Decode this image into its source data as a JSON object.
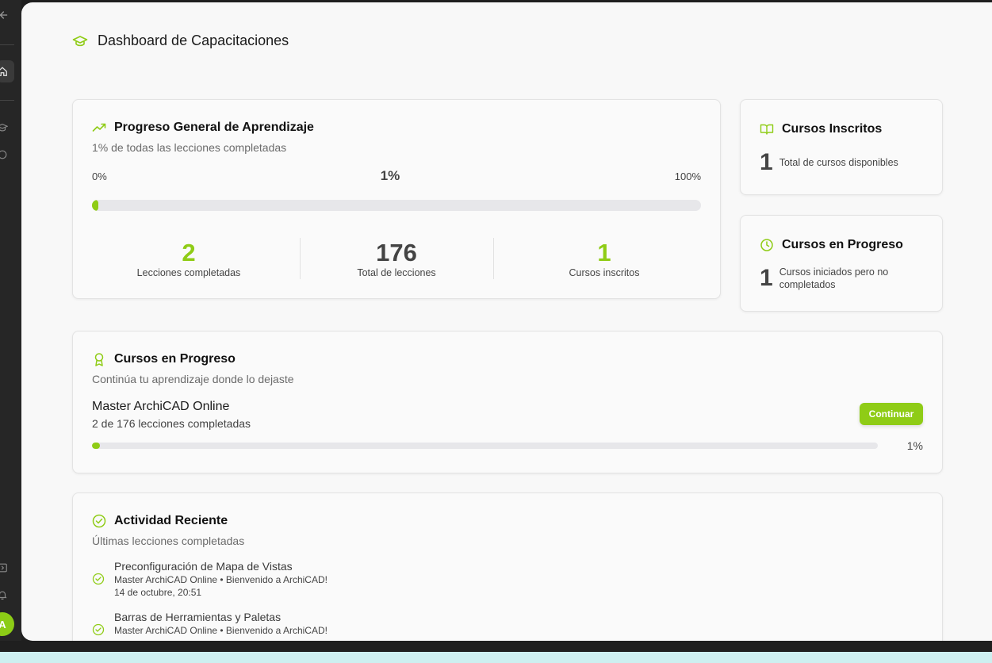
{
  "colors": {
    "accent": "#8fcc16",
    "sidebar": "#262626",
    "surface": "#f8f8f8"
  },
  "sidebar": {
    "icons": [
      "arrow-left-icon",
      "home-icon",
      "graduation-cap-icon",
      "circle-icon",
      "panel-icon",
      "bell-icon"
    ],
    "avatar_initial": "A"
  },
  "header": {
    "title": "Dashboard de Capacitaciones",
    "icon": "graduation-cap-icon"
  },
  "progress_card": {
    "title": "Progreso General de Aprendizaje",
    "subtitle": "1% de todas las lecciones completadas",
    "min_label": "0%",
    "current_label": "1%",
    "max_label": "100%",
    "progress_fraction": 0.01,
    "stats": [
      {
        "value": "2",
        "label": "Lecciones completadas",
        "color": "#8fcc16"
      },
      {
        "value": "176",
        "label": "Total de lecciones",
        "color": "#444444"
      },
      {
        "value": "1",
        "label": "Cursos inscritos",
        "color": "#8fcc16"
      }
    ]
  },
  "enrolled_card": {
    "title": "Cursos Inscritos",
    "value": "1",
    "description": "Total de cursos disponibles"
  },
  "in_progress_card": {
    "title": "Cursos en Progreso",
    "value": "1",
    "description": "Cursos iniciados pero no completados"
  },
  "courses_section": {
    "title": "Cursos en Progreso",
    "subtitle": "Continúa tu aprendizaje donde lo dejaste",
    "course": {
      "name": "Master ArchiCAD Online",
      "lessons_text": "2 de 176 lecciones completadas",
      "button_label": "Continuar",
      "progress_label": "1%",
      "progress_fraction": 0.01
    }
  },
  "activity_section": {
    "title": "Actividad Reciente",
    "subtitle": "Últimas lecciones completadas",
    "items": [
      {
        "title": "Preconfiguración de Mapa de Vistas",
        "meta": "Master ArchiCAD Online • Bienvenido a ArchiCAD!",
        "date": "14 de octubre, 20:51"
      },
      {
        "title": "Barras de Herramientas y Paletas",
        "meta": "Master ArchiCAD Online • Bienvenido a ArchiCAD!",
        "date": ""
      }
    ]
  }
}
